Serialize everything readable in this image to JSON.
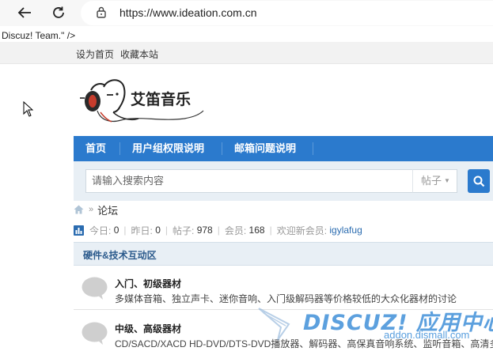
{
  "browser": {
    "url": "https://www.ideation.com.cn"
  },
  "stray_text": "Discuz! Team.\" />",
  "topbar": {
    "links": [
      "设为首页",
      "收藏本站"
    ]
  },
  "logo": {
    "text": "艾笛音乐"
  },
  "nav": {
    "items": [
      "首页",
      "用户组权限说明",
      "邮箱问题说明"
    ]
  },
  "search": {
    "placeholder": "请输入搜索内容",
    "type": "帖子"
  },
  "breadcrumb": {
    "current": "论坛"
  },
  "stats": {
    "today_label": "今日:",
    "today": "0",
    "yesterday_label": "昨日:",
    "yesterday": "0",
    "posts_label": "帖子:",
    "posts": "978",
    "members_label": "会员:",
    "members": "168",
    "welcome_label": "欢迎新会员:",
    "new_member": "igylafug"
  },
  "forum_group": {
    "title": "硬件&技术互动区",
    "forums": [
      {
        "name": "入门、初级器材",
        "desc": "多媒体音箱、独立声卡、迷你音响、入门级解码器等价格较低的大众化器材的讨论"
      },
      {
        "name": "中级、高级器材",
        "desc": "CD/SACD/XACD HD-DVD/DTS-DVD播放器、解码器、高保真音响系统、监听音箱、高清多声道"
      }
    ]
  },
  "watermark": {
    "main": "DISCUZ! 应用中心",
    "sub": "addon.dismall.com"
  },
  "colors": {
    "nav_blue": "#2b7acd",
    "header_bg": "#e8eff5",
    "link_blue": "#2b6cb0"
  }
}
